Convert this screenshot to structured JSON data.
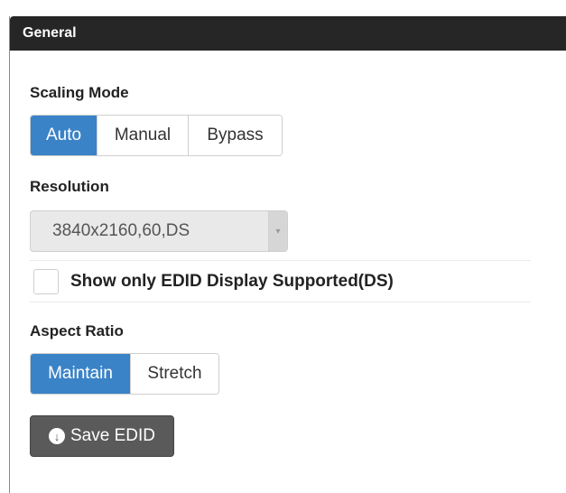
{
  "panel": {
    "title": "General"
  },
  "scaling_mode": {
    "label": "Scaling Mode",
    "options": [
      "Auto",
      "Manual",
      "Bypass"
    ],
    "selected": "Auto"
  },
  "resolution": {
    "label": "Resolution",
    "value": "3840x2160,60,DS"
  },
  "edid_filter": {
    "label": "Show only EDID Display Supported(DS)",
    "checked": false
  },
  "aspect_ratio": {
    "label": "Aspect Ratio",
    "options": [
      "Maintain",
      "Stretch"
    ],
    "selected": "Maintain"
  },
  "save_edid": {
    "label": "Save EDID",
    "icon": "download-circle-icon"
  },
  "colors": {
    "header_bg": "#262626",
    "accent": "#3a83c6",
    "save_button_bg": "#5a5a5a"
  }
}
